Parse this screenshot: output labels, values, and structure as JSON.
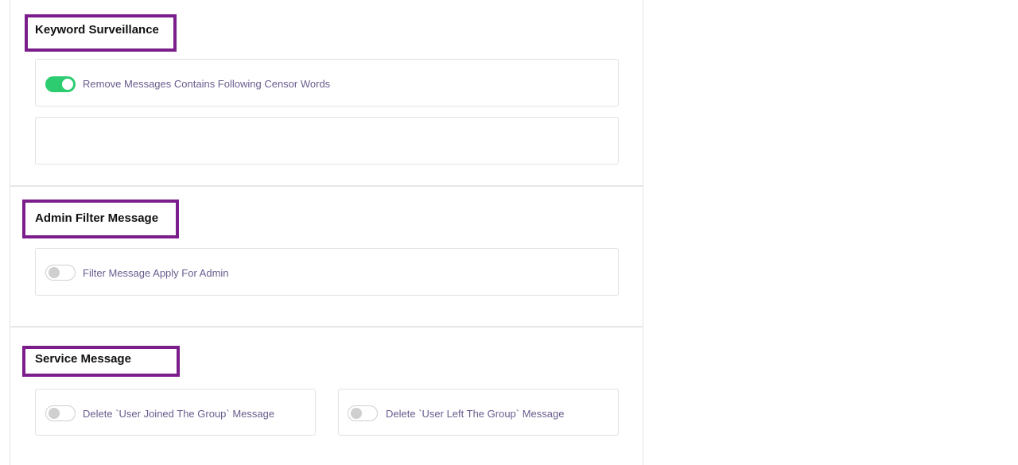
{
  "keyword_surveillance": {
    "title": "Keyword Surveillance",
    "remove_censor_words": {
      "label": "Remove Messages Contains Following Censor Words",
      "enabled": true
    },
    "censor_words_value": ""
  },
  "admin_filter": {
    "title": "Admin Filter Message",
    "filter_apply_admin": {
      "label": "Filter Message Apply For Admin",
      "enabled": false
    }
  },
  "service_message": {
    "title": "Service Message",
    "delete_user_joined": {
      "label": "Delete `User Joined The Group` Message",
      "enabled": false
    },
    "delete_user_left": {
      "label": "Delete `User Left The Group` Message",
      "enabled": false
    }
  },
  "colors": {
    "highlight_border": "#7b1e8c",
    "toggle_on": "#2ecc71",
    "label_text": "#6a5c8e"
  }
}
